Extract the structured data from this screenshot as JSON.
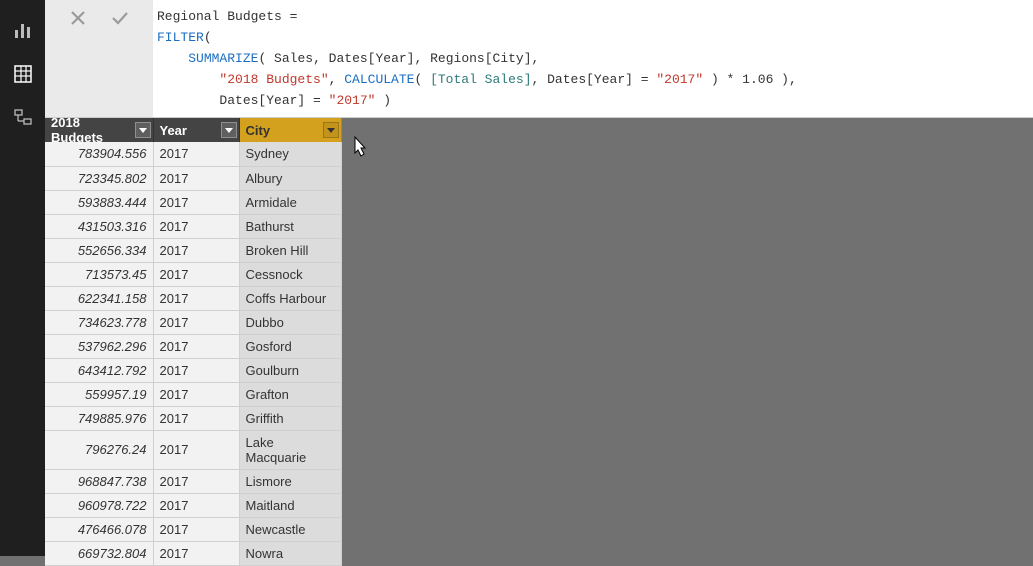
{
  "sidebar": {
    "items": [
      {
        "name": "report-view"
      },
      {
        "name": "data-view"
      },
      {
        "name": "model-view"
      }
    ],
    "active": "data-view"
  },
  "formula_bar": {
    "cancel_title": "Cancel",
    "commit_title": "Commit",
    "tokens": {
      "l1_measure": "Regional Budgets ",
      "l1_eq": "=",
      "l2_indent": "",
      "l2_filter": "FILTER",
      "l2_paren": "(",
      "l3_indent": "    ",
      "l3_summarize": "SUMMARIZE",
      "l3_open": "( ",
      "l3_sales": "Sales",
      "l3_c1": ", ",
      "l3_datesyear": "Dates[Year]",
      "l3_c2": ", ",
      "l3_regionscity": "Regions[City]",
      "l3_c3": ",",
      "l4_indent": "        ",
      "l4_str": "\"2018 Budgets\"",
      "l4_c1": ", ",
      "l4_calc": "CALCULATE",
      "l4_open": "( ",
      "l4_totalsales": "[Total Sales]",
      "l4_c2": ", ",
      "l4_datesyear": "Dates[Year]",
      "l4_eq": " = ",
      "l4_year": "\"2017\"",
      "l4_close": " ) * 1.06 ),",
      "l5_indent": "        ",
      "l5_datesyear": "Dates[Year]",
      "l5_eq": " = ",
      "l5_year": "\"2017\"",
      "l5_close": " )"
    }
  },
  "table": {
    "columns": {
      "budget": "2018 Budgets",
      "year": "Year",
      "city": "City"
    },
    "selected_column": "city",
    "rows": [
      {
        "budget": "783904.556",
        "year": "2017",
        "city": "Sydney"
      },
      {
        "budget": "723345.802",
        "year": "2017",
        "city": "Albury"
      },
      {
        "budget": "593883.444",
        "year": "2017",
        "city": "Armidale"
      },
      {
        "budget": "431503.316",
        "year": "2017",
        "city": "Bathurst"
      },
      {
        "budget": "552656.334",
        "year": "2017",
        "city": "Broken Hill"
      },
      {
        "budget": "713573.45",
        "year": "2017",
        "city": "Cessnock"
      },
      {
        "budget": "622341.158",
        "year": "2017",
        "city": "Coffs Harbour"
      },
      {
        "budget": "734623.778",
        "year": "2017",
        "city": "Dubbo"
      },
      {
        "budget": "537962.296",
        "year": "2017",
        "city": "Gosford"
      },
      {
        "budget": "643412.792",
        "year": "2017",
        "city": "Goulburn"
      },
      {
        "budget": "559957.19",
        "year": "2017",
        "city": "Grafton"
      },
      {
        "budget": "749885.976",
        "year": "2017",
        "city": "Griffith"
      },
      {
        "budget": "796276.24",
        "year": "2017",
        "city": "Lake Macquarie"
      },
      {
        "budget": "968847.738",
        "year": "2017",
        "city": "Lismore"
      },
      {
        "budget": "960978.722",
        "year": "2017",
        "city": "Maitland"
      },
      {
        "budget": "476466.078",
        "year": "2017",
        "city": "Newcastle"
      },
      {
        "budget": "669732.804",
        "year": "2017",
        "city": "Nowra"
      }
    ]
  }
}
